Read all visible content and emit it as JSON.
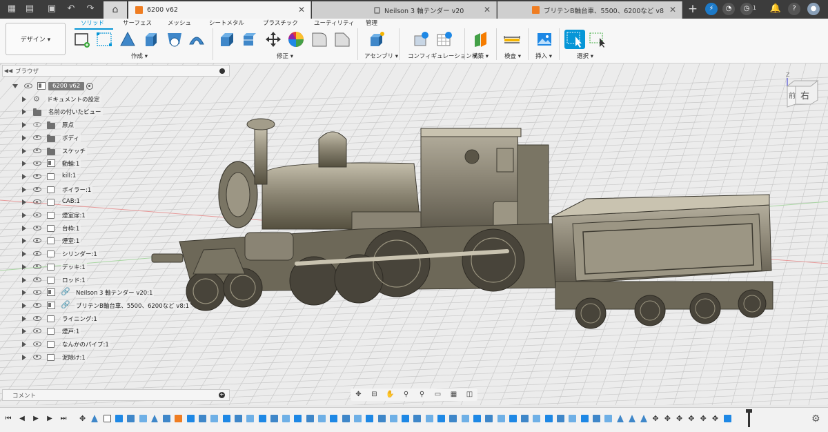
{
  "tabbar": {
    "document_tabs": [
      {
        "label": "6200 v62",
        "active": true
      },
      {
        "label": "Neilson 3 軸テンダー v20",
        "active": false,
        "locked": true
      },
      {
        "label": "ブリテンB軸台車、5500、6200など v8",
        "active": false
      }
    ],
    "notification_count": "1",
    "job_count": "1"
  },
  "ribbon": {
    "workspace_label": "デザイン ▾",
    "tabs": [
      "ソリッド",
      "サーフェス",
      "メッシュ",
      "シートメタル",
      "プラスチック",
      "ユーティリティ",
      "管理"
    ],
    "active_tab": "ソリッド",
    "groups": {
      "create": "作成 ▾",
      "modify": "修正 ▾",
      "assemble": "アセンブリ ▾",
      "configure": "コンフィギュレーション ▾",
      "construct": "構築 ▾",
      "inspect": "検査 ▾",
      "insert": "挿入 ▾",
      "select": "選択 ▾"
    }
  },
  "browser": {
    "title": "ブラウザ",
    "root_label": "6200 v62",
    "items": [
      {
        "label": "ドキュメントの設定",
        "icon": "gear-icon",
        "visible": null
      },
      {
        "label": "名前の付いたビュー",
        "icon": "folder-icon",
        "visible": null
      },
      {
        "label": "原点",
        "icon": "folder-icon",
        "visible": false
      },
      {
        "label": "ボディ",
        "icon": "folder-icon",
        "visible": true
      },
      {
        "label": "スケッチ",
        "icon": "folder-icon",
        "visible": true
      },
      {
        "label": "動輪:1",
        "icon": "component-icon",
        "visible": true
      },
      {
        "label": "kill:1",
        "icon": "body-icon",
        "visible": true
      },
      {
        "label": "ボイラー:1",
        "icon": "body-icon",
        "visible": true
      },
      {
        "label": "CAB:1",
        "icon": "body-icon",
        "visible": true
      },
      {
        "label": "煙室扉:1",
        "icon": "body-icon",
        "visible": true
      },
      {
        "label": "台枠:1",
        "icon": "body-icon",
        "visible": true
      },
      {
        "label": "煙室:1",
        "icon": "body-icon",
        "visible": true
      },
      {
        "label": "シリンダー:1",
        "icon": "body-icon",
        "visible": true
      },
      {
        "label": "デッキ:1",
        "icon": "body-icon",
        "visible": true
      },
      {
        "label": "ロッド:1",
        "icon": "body-icon",
        "visible": true
      },
      {
        "label": "Neilson 3 軸テンダー v20:1",
        "icon": "linked-component-icon",
        "visible": true
      },
      {
        "label": "ブリテンB軸台車、5500、6200など v8:1",
        "icon": "linked-component-icon",
        "visible": true
      },
      {
        "label": "ライニング:1",
        "icon": "body-icon",
        "visible": true
      },
      {
        "label": "煙戸:1",
        "icon": "body-icon",
        "visible": true
      },
      {
        "label": "なんかのパイプ:1",
        "icon": "body-icon",
        "visible": true
      },
      {
        "label": "泥除け:1",
        "icon": "body-icon",
        "visible": true
      }
    ]
  },
  "viewcube": {
    "front": "前",
    "right": "右",
    "axis_z": "Z"
  },
  "comments": {
    "title": "コメント"
  },
  "colors": {
    "accent": "#0696d7",
    "tab_bar": "#3c3c3c",
    "model": "#8a8474",
    "orange": "#ef7d22"
  }
}
